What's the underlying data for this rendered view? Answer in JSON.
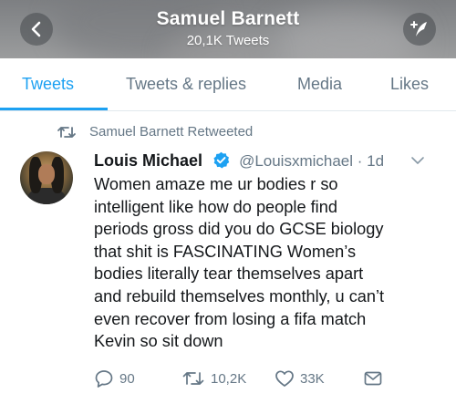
{
  "header": {
    "title": "Samuel Barnett",
    "tweet_count": "20,1K Tweets"
  },
  "tabs": [
    {
      "label": "Tweets",
      "active": true
    },
    {
      "label": "Tweets & replies",
      "active": false
    },
    {
      "label": "Media",
      "active": false
    },
    {
      "label": "Likes",
      "active": false
    }
  ],
  "tweet": {
    "retweeted_by": "Samuel Barnett Retweeted",
    "author_name": "Louis Michael",
    "handle_time": "@Louisxmichael · 1d",
    "lines": [
      "Women amaze me ur bodies r so",
      "intelligent like how do people find",
      "periods gross did you do GCSE biology",
      "that shit is FASCINATING Women’s",
      "bodies literally tear themselves apart",
      "and rebuild themselves monthly, u can’t",
      "even recover from losing a fifa match",
      "Kevin so sit down"
    ],
    "replies": "90",
    "retweets": "10,2K",
    "likes": "33K"
  },
  "colors": {
    "accent": "#1da1f2",
    "secondary_text": "#657786",
    "verified": "#1da1f2"
  },
  "icons": [
    "back-arrow-icon",
    "compose-tweet-icon",
    "retweet-icon",
    "verified-badge-icon",
    "chevron-down-icon",
    "reply-icon",
    "like-icon",
    "direct-message-icon"
  ]
}
